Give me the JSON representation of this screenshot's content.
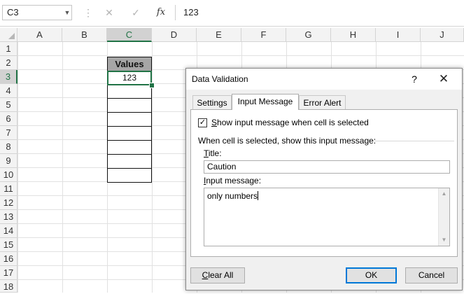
{
  "formula_bar": {
    "name_box": "C3",
    "cancel_icon": "✕",
    "enter_icon": "✓",
    "fx_label": "fx",
    "formula_value": "123"
  },
  "sheet": {
    "columns": [
      "A",
      "B",
      "C",
      "D",
      "E",
      "F",
      "G",
      "H",
      "I",
      "J"
    ],
    "selected_column": "C",
    "rows": [
      "1",
      "2",
      "3",
      "4",
      "5",
      "6",
      "7",
      "8",
      "9",
      "10",
      "11",
      "12",
      "13",
      "14",
      "15",
      "16",
      "17",
      "18"
    ],
    "selected_row": "3",
    "table_header": "Values",
    "table_values": [
      "123",
      "",
      "",
      "",
      "",
      "",
      "",
      ""
    ]
  },
  "dialog": {
    "title": "Data Validation",
    "help_label": "?",
    "close_label": "✕",
    "tabs": [
      {
        "label": "Settings",
        "active": false
      },
      {
        "label": "Input Message",
        "active": true
      },
      {
        "label": "Error Alert",
        "active": false
      }
    ],
    "show_message_checkbox": {
      "checked": true,
      "mark": "✓",
      "label_accel": "S",
      "label_rest": "how input message when cell is selected"
    },
    "section_label": "When cell is selected, show this input message:",
    "title_label_accel": "T",
    "title_label_rest": "itle:",
    "title_value": "Caution",
    "input_message_label_accel": "I",
    "input_message_label_rest": "nput message:",
    "input_message_value": "only numbers",
    "buttons": {
      "clear_all_accel": "C",
      "clear_all_rest": "lear All",
      "ok": "OK",
      "cancel": "Cancel"
    }
  },
  "colors": {
    "excel_green": "#217346",
    "focus_blue": "#0078d7",
    "table_header_fill": "#a6a6a6"
  }
}
